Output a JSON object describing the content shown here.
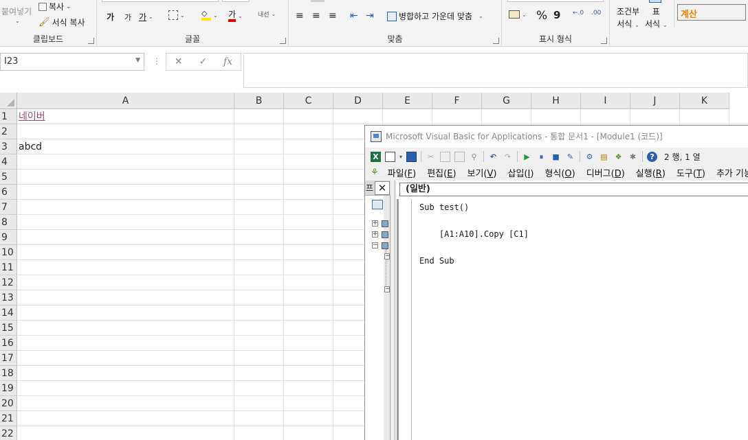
{
  "ribbon": {
    "clipboard": {
      "paste_label": "붙여넣기",
      "copy_label": "복사",
      "format_painter_label": "서식 복사",
      "group_label": "클립보드"
    },
    "font": {
      "grow_label": "가",
      "shrink_label": "가",
      "underline_label": "가",
      "font_color_label": "가",
      "phonetic_label": "내선",
      "group_label": "글꼴"
    },
    "alignment": {
      "merge_center_label": "병합하고 가운데 맞춤",
      "group_label": "맞춤"
    },
    "number": {
      "percent_label": "%",
      "comma_label": "9",
      "group_label": "표시 형식"
    },
    "styles": {
      "conditional_label_1": "조건부",
      "conditional_label_2": "서식",
      "table_label_1": "표",
      "table_label_2": "서식",
      "cell_style_label": "계산"
    }
  },
  "formula_bar": {
    "name_box": "I23",
    "cancel_symbol": "✕",
    "enter_symbol": "✓",
    "fx_symbol": "fx",
    "formula": ""
  },
  "sheet": {
    "columns": [
      "A",
      "B",
      "C",
      "D",
      "E",
      "F",
      "G",
      "H",
      "I",
      "J",
      "K"
    ],
    "rows": [
      "1",
      "2",
      "3",
      "4",
      "5",
      "6",
      "7",
      "8",
      "9",
      "10",
      "11",
      "12",
      "13",
      "14",
      "15",
      "16",
      "17",
      "18",
      "19",
      "20",
      "21",
      "22"
    ],
    "cells": {
      "A1": "네이버",
      "A3": "abcd"
    }
  },
  "vbe": {
    "title": "Microsoft Visual Basic for Applications - 통합 문서1 - [Module1 (코드)]",
    "position": "2 행, 1 열",
    "menu": [
      {
        "label": "파일(",
        "key": "F",
        "end": ")"
      },
      {
        "label": "편집(",
        "key": "E",
        "end": ")"
      },
      {
        "label": "보기(",
        "key": "V",
        "end": ")"
      },
      {
        "label": "삽입(",
        "key": "I",
        "end": ")"
      },
      {
        "label": "형식(",
        "key": "O",
        "end": ")"
      },
      {
        "label": "디버그(",
        "key": "D",
        "end": ")"
      },
      {
        "label": "실행(",
        "key": "R",
        "end": ")"
      },
      {
        "label": "도구(",
        "key": "T",
        "end": ")"
      },
      {
        "label": "추가 기능",
        "key": "",
        "end": ""
      }
    ],
    "project_head": "프",
    "project_close": "✕",
    "code_object": "(일반)",
    "code_lines": [
      "Sub test()",
      "",
      "    [A1:A10].Copy [C1]",
      "",
      "End Sub"
    ]
  }
}
